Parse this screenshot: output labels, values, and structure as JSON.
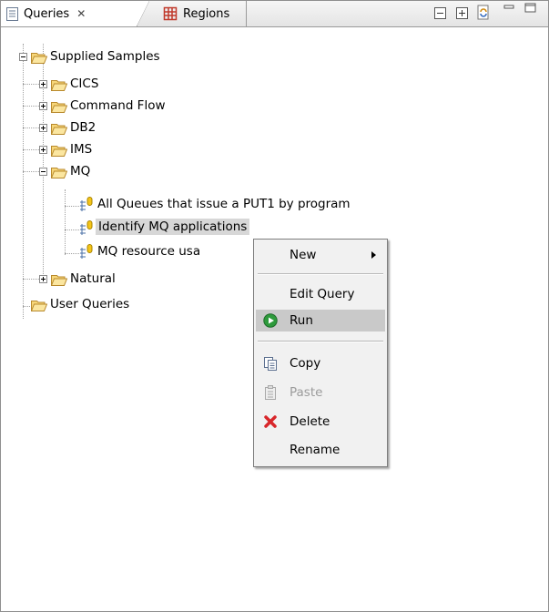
{
  "tabs": {
    "queries": {
      "label": "Queries",
      "close_icon": "close-icon"
    },
    "regions": {
      "label": "Regions"
    }
  },
  "tree": {
    "root": {
      "label": "Supplied Samples"
    },
    "folders": [
      {
        "label": "CICS"
      },
      {
        "label": "Command Flow"
      },
      {
        "label": "DB2"
      },
      {
        "label": "IMS"
      },
      {
        "label": "MQ"
      },
      {
        "label": "Natural"
      }
    ],
    "mq_queries": [
      {
        "label": "All Queues that issue a PUT1 by program"
      },
      {
        "label": "Identify MQ applications"
      },
      {
        "label": "MQ resource usa"
      }
    ],
    "user_queries": {
      "label": "User Queries"
    }
  },
  "context_menu": {
    "new": "New",
    "edit_query": "Edit Query",
    "run": "Run",
    "copy": "Copy",
    "paste": "Paste",
    "delete": "Delete",
    "rename": "Rename"
  },
  "colors": {
    "folder_fill": "#f7d77a",
    "folder_edge": "#b8892c",
    "selection": "#d7d7d7",
    "menu_bg": "#f1f1f1",
    "menu_highlight": "#c9c9c9",
    "run_green": "#2e9a3c",
    "delete_red": "#d8262a",
    "regions_icon": "#c0392b"
  }
}
